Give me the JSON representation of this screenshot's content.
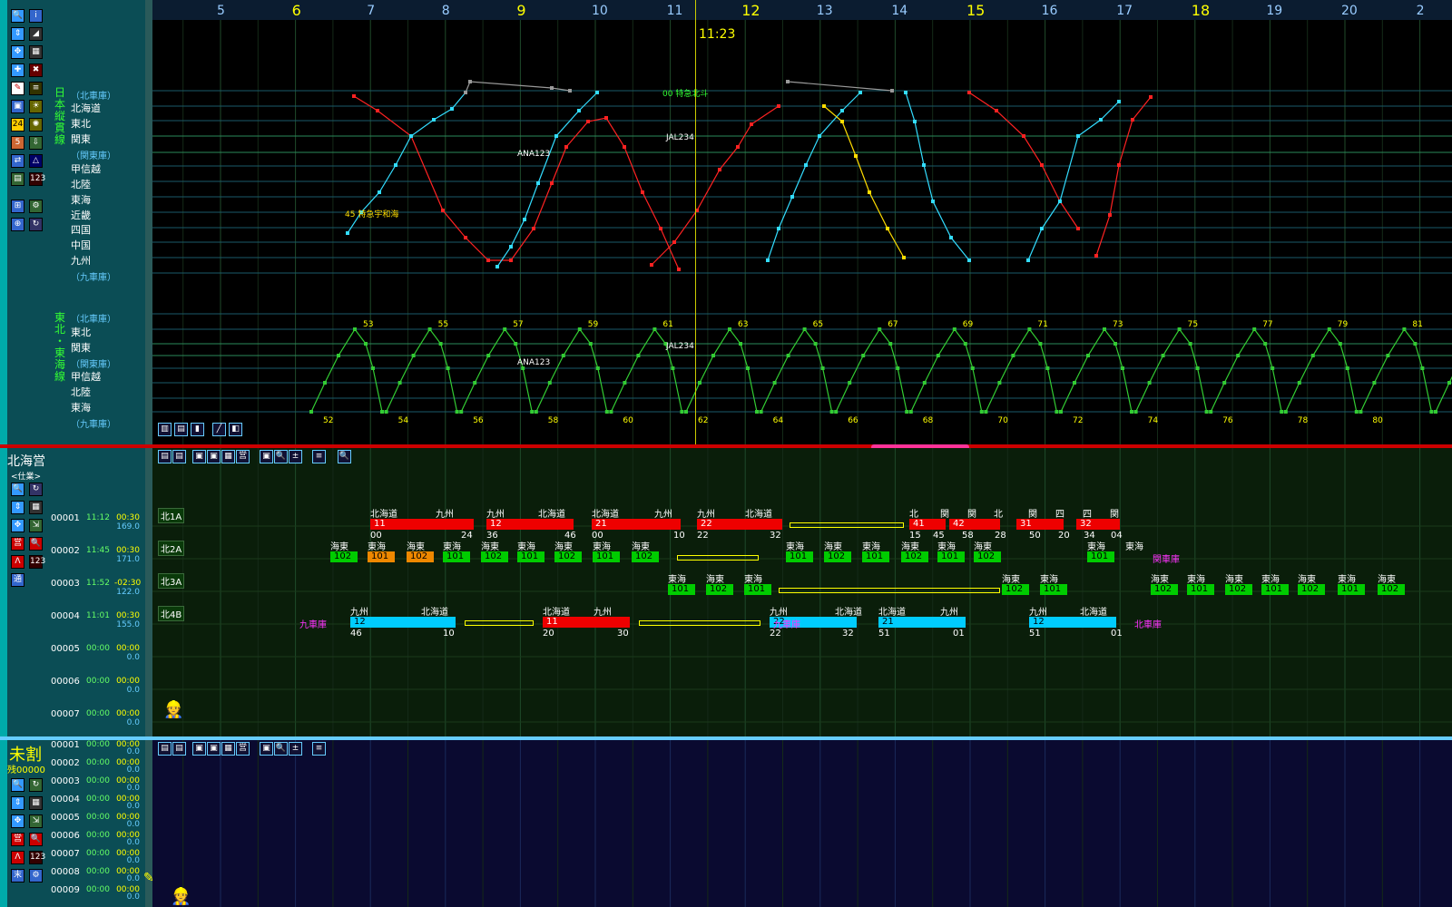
{
  "time_axis": {
    "hours": [
      "5",
      "6",
      "7",
      "8",
      "9",
      "10",
      "11",
      "12",
      "13",
      "14",
      "15",
      "16",
      "17",
      "18",
      "19",
      "20",
      "2"
    ],
    "current_time": "11:23"
  },
  "diagram_top": {
    "line_label": "日本縦貫線",
    "stations": [
      "（北車庫）",
      "北海道",
      "東北",
      "関東",
      "（関東庫）",
      "甲信越",
      "北陸",
      "東海",
      "近畿",
      "四国",
      "中国",
      "九州",
      "（九車庫）"
    ],
    "train_labels": [
      {
        "num": "00",
        "name": "特急北斗"
      },
      {
        "num": "45",
        "name": "特急宇和海"
      }
    ],
    "flight_labels": [
      "ANA123",
      "JAL234"
    ]
  },
  "diagram_bottom": {
    "line_label": "東北・東海線",
    "stations": [
      "（北車庫）",
      "東北",
      "関東",
      "（関東庫）",
      "甲信越",
      "北陸",
      "東海",
      "（九車庫）"
    ],
    "flight_labels": [
      "ANA123",
      "JAL234"
    ],
    "bottom_numbers": [
      "52",
      "54",
      "56",
      "58",
      "60",
      "62",
      "64",
      "66",
      "68",
      "70",
      "72",
      "74",
      "76",
      "78",
      "80"
    ],
    "top_numbers": [
      "53",
      "55",
      "57",
      "59",
      "61",
      "63",
      "65",
      "67",
      "69",
      "71",
      "73",
      "75",
      "77",
      "79",
      "81"
    ]
  },
  "hokkai_panel": {
    "title": "北海営",
    "subtitle": "<仕業>",
    "rows": [
      {
        "id": "00001",
        "time": "11:12",
        "dur": "00:30",
        "val": "169.0",
        "code": "北1A"
      },
      {
        "id": "00002",
        "time": "11:45",
        "dur": "00:30",
        "val": "171.0",
        "code": "北2A"
      },
      {
        "id": "00003",
        "time": "11:52",
        "dur": "-02:30",
        "val": "122.0",
        "code": "北3A"
      },
      {
        "id": "00004",
        "time": "11:01",
        "dur": "00:30",
        "val": "155.0",
        "code": "北4B"
      },
      {
        "id": "00005",
        "time": "00:00",
        "dur": "00:00",
        "val": "0.0",
        "code": ""
      },
      {
        "id": "00006",
        "time": "00:00",
        "dur": "00:00",
        "val": "0.0",
        "code": ""
      },
      {
        "id": "00007",
        "time": "00:00",
        "dur": "00:00",
        "val": "0.0",
        "code": ""
      }
    ],
    "toolbar_icon_label": "通"
  },
  "mi_panel": {
    "title": "未割",
    "subtitle": "残00000",
    "rows": [
      {
        "id": "00001",
        "time": "00:00",
        "dur": "00:00",
        "val": "0.0"
      },
      {
        "id": "00002",
        "time": "00:00",
        "dur": "00:00",
        "val": "0.0"
      },
      {
        "id": "00003",
        "time": "00:00",
        "dur": "00:00",
        "val": "0.0"
      },
      {
        "id": "00004",
        "time": "00:00",
        "dur": "00:00",
        "val": "0.0"
      },
      {
        "id": "00005",
        "time": "00:00",
        "dur": "00:00",
        "val": "0.0"
      },
      {
        "id": "00006",
        "time": "00:00",
        "dur": "00:00",
        "val": "0.0"
      },
      {
        "id": "00007",
        "time": "00:00",
        "dur": "00:00",
        "val": "0.0"
      },
      {
        "id": "00008",
        "time": "00:00",
        "dur": "00:00",
        "val": "0.0"
      },
      {
        "id": "00009",
        "time": "00:00",
        "dur": "00:00",
        "val": "0.0"
      }
    ]
  },
  "row1": {
    "labels": [
      "北海道",
      "九州",
      "九州",
      "北海道",
      "北海道",
      "九州",
      "九州",
      "北海道",
      "北",
      "関",
      "関",
      "北",
      "関",
      "四",
      "四",
      "関"
    ],
    "bars": [
      "11",
      "12",
      "21",
      "22",
      "41",
      "42",
      "31",
      "32"
    ],
    "times": [
      "00",
      "24",
      "36",
      "46",
      "00",
      "10",
      "22",
      "32",
      "15",
      "45",
      "58",
      "28",
      "50",
      "20",
      "34",
      "04"
    ]
  },
  "row2": {
    "labels": [
      "海東",
      "東海",
      "海東",
      "東海",
      "海東",
      "東海",
      "海東",
      "東海",
      "海東",
      "東海",
      "海東",
      "東海",
      "海東",
      "東海",
      "海東",
      "東海",
      "東海",
      "海東"
    ],
    "bars": [
      "102",
      "101",
      "102",
      "101",
      "102",
      "101",
      "102",
      "101",
      "102",
      "101",
      "102",
      "101",
      "102",
      "101",
      "102",
      "101"
    ],
    "depot": "関車庫"
  },
  "row3": {
    "labels": [
      "東海",
      "海東",
      "東海",
      "海東",
      "東海",
      "海東",
      "東海",
      "海東",
      "東海",
      "海東",
      "東海",
      "海東"
    ],
    "bars": [
      "101",
      "102",
      "101",
      "102",
      "101",
      "102",
      "101",
      "102",
      "101",
      "102",
      "101",
      "102"
    ]
  },
  "row4": {
    "labels": [
      "九州",
      "北海道",
      "北海道",
      "九州",
      "九州",
      "北海道",
      "北海道",
      "九州",
      "九州",
      "北海道"
    ],
    "bars": [
      "12",
      "11",
      "22",
      "21",
      "12"
    ],
    "depot_left": "九車庫",
    "depot_mid": "九車庫",
    "depot_right": "北車庫",
    "times": [
      "46",
      "10",
      "20",
      "30",
      "22",
      "32",
      "51",
      "01",
      "51",
      "01"
    ]
  }
}
